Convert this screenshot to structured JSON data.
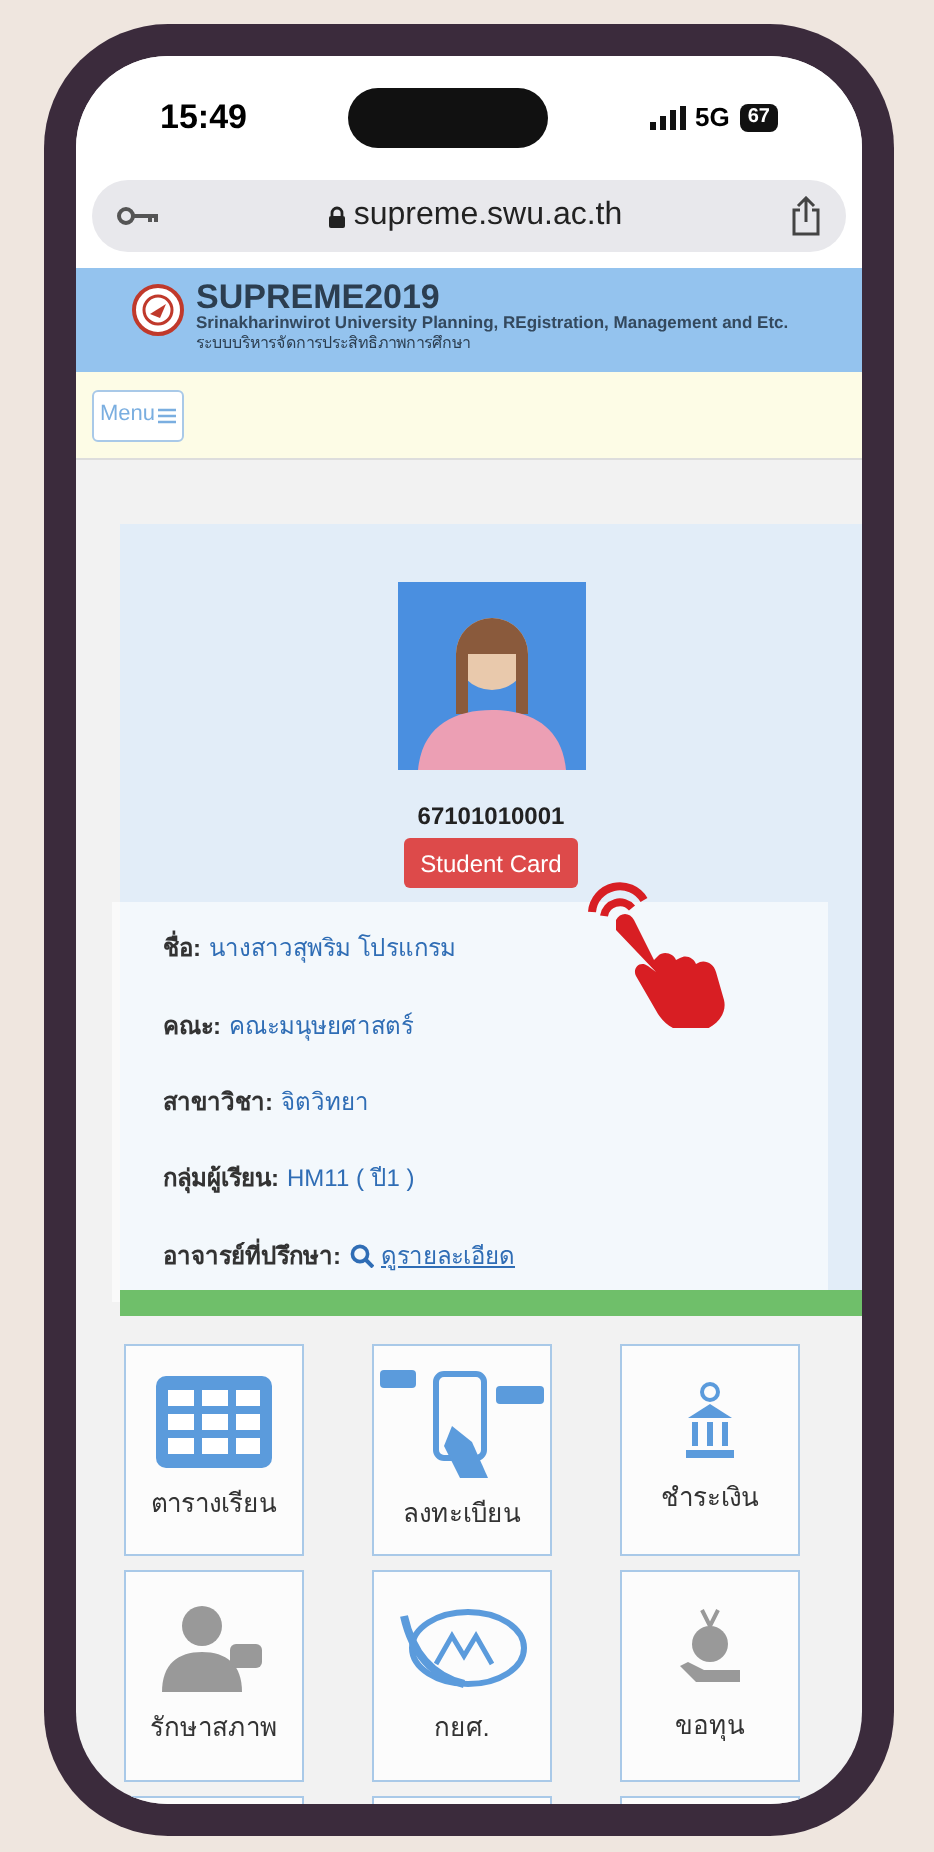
{
  "status_bar": {
    "time": "15:49",
    "network": "5G",
    "battery": "67"
  },
  "address_bar": {
    "url": "supreme.swu.ac.th"
  },
  "header": {
    "title": "SUPREME2019",
    "subtitle": "Srinakharinwirot University Planning, REgistration, Management and Etc.",
    "subtitle_thai": "ระบบบริหารจัดการประสิทธิภาพการศึกษา"
  },
  "menu_button": "Menu",
  "profile": {
    "student_id": "67101010001",
    "card_button": "Student Card",
    "fields": [
      {
        "label": "ชื่อ:",
        "value": "นางสาวสุพริม โปรแกรม"
      },
      {
        "label": "คณะ:",
        "value": "คณะมนุษยศาสตร์"
      },
      {
        "label": "สาขาวิชา:",
        "value": "จิตวิทยา"
      },
      {
        "label": "กลุ่มผู้เรียน:",
        "value": "HM11 ( ปี1 )"
      },
      {
        "label": "อาจารย์ที่ปรึกษา:",
        "value": "ดูรายละเอียด",
        "kind": "link"
      }
    ]
  },
  "tiles": [
    {
      "label": "ตารางเรียน"
    },
    {
      "label": "ลงทะเบียน"
    },
    {
      "label": "ชำระเงิน"
    },
    {
      "label": "รักษาสภาพ"
    },
    {
      "label": "กยศ."
    },
    {
      "label": "ขอทุน"
    }
  ]
}
